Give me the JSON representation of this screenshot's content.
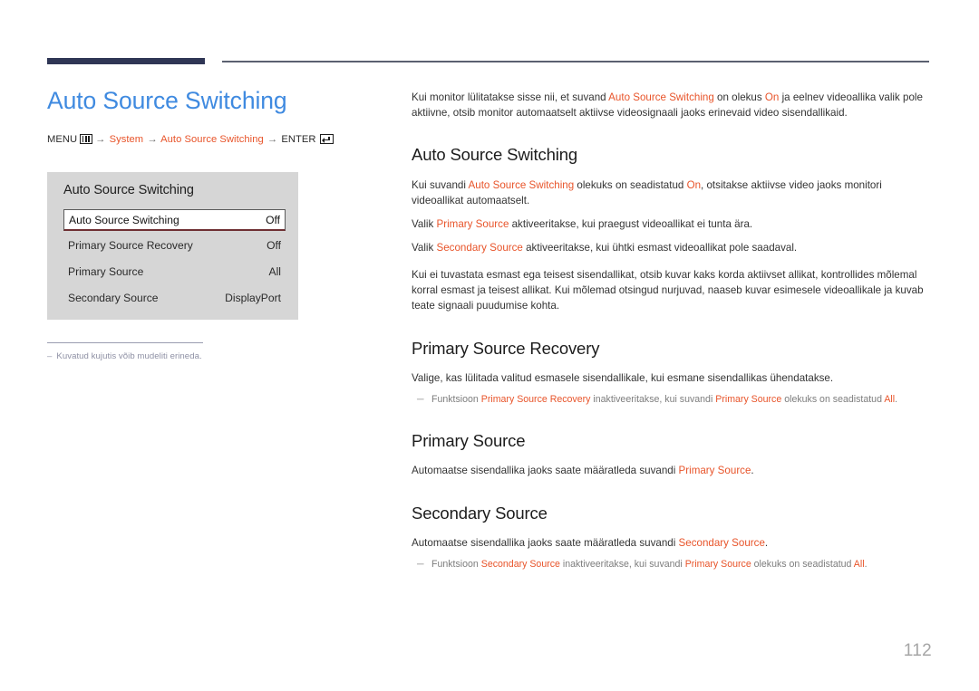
{
  "header": {
    "accent_bar_color": "#2f3655",
    "rule_color": "#5b6070"
  },
  "left": {
    "page_title": "Auto Source Switching",
    "menu_path": {
      "menu_label": "MENU",
      "menu_icon": "menu-icon",
      "arrow": "→",
      "step1": "System",
      "step2": "Auto Source Switching",
      "enter_label": "ENTER",
      "enter_icon": "enter-icon"
    },
    "osd": {
      "title": "Auto Source Switching",
      "rows": [
        {
          "label": "Auto Source Switching",
          "value": "Off",
          "selected": true
        },
        {
          "label": "Primary Source Recovery",
          "value": "Off",
          "selected": false
        },
        {
          "label": "Primary Source",
          "value": "All",
          "selected": false
        },
        {
          "label": "Secondary Source",
          "value": "DisplayPort",
          "selected": false
        }
      ]
    },
    "footnote": {
      "dash": "–",
      "text": "Kuvatud kujutis võib mudeliti erineda."
    }
  },
  "right": {
    "intro": {
      "part1": "Kui monitor lülitatakse sisse nii, et suvand ",
      "accent1": "Auto Source Switching",
      "part2": " on olekus ",
      "accent2": "On",
      "part3": " ja eelnev videoallika valik pole aktiivne, otsib monitor automaatselt aktiivse videosignaali jaoks erinevaid video sisendallikaid."
    },
    "sections": [
      {
        "heading": "Auto Source Switching",
        "paragraphs": [
          {
            "part1": "Kui suvandi ",
            "accent1": "Auto Source Switching",
            "part2": " olekuks on seadistatud ",
            "accent2": "On",
            "part3": ", otsitakse aktiivse video jaoks monitori videoallikat automaatselt."
          },
          {
            "part1": "Valik ",
            "accent1": "Primary Source",
            "part2": " aktiveeritakse, kui praegust videoallikat ei tunta ära.",
            "accent2": "",
            "part3": ""
          },
          {
            "part1": "Valik ",
            "accent1": "Secondary Source",
            "part2": " aktiveeritakse, kui ühtki esmast videoallikat pole saadaval.",
            "accent2": "",
            "part3": ""
          },
          {
            "part1": "Kui ei tuvastata esmast ega teisest sisendallikat, otsib kuvar kaks korda aktiivset allikat, kontrollides mõlemal korral esmast ja teisest allikat. Kui mõlemad otsingud nurjuvad, naaseb kuvar esimesele videoallikale ja kuvab teate signaali puudumise kohta.",
            "accent1": "",
            "part2": "",
            "accent2": "",
            "part3": ""
          }
        ],
        "note": null
      },
      {
        "heading": "Primary Source Recovery",
        "paragraphs": [
          {
            "part1": "Valige, kas lülitada valitud esmasele sisendallikale, kui esmane sisendallikas ühendatakse.",
            "accent1": "",
            "part2": "",
            "accent2": "",
            "part3": ""
          }
        ],
        "note": {
          "dash": "─",
          "part1": "Funktsioon ",
          "accent1": "Primary Source Recovery",
          "part2": " inaktiveeritakse, kui suvandi ",
          "accent2": "Primary Source",
          "part3": " olekuks on seadistatud ",
          "accent3": "All",
          "part4": "."
        }
      },
      {
        "heading": "Primary Source",
        "paragraphs": [
          {
            "part1": "Automaatse sisendallika jaoks saate määratleda suvandi ",
            "accent1": "Primary Source",
            "part2": ".",
            "accent2": "",
            "part3": ""
          }
        ],
        "note": null
      },
      {
        "heading": "Secondary Source",
        "paragraphs": [
          {
            "part1": "Automaatse sisendallika jaoks saate määratleda suvandi ",
            "accent1": "Secondary Source",
            "part2": ".",
            "accent2": "",
            "part3": ""
          }
        ],
        "note": {
          "dash": "─",
          "part1": "Funktsioon ",
          "accent1": "Secondary Source",
          "part2": " inaktiveeritakse, kui suvandi ",
          "accent2": "Primary Source",
          "part3": " olekuks on seadistatud ",
          "accent3": "All",
          "part4": "."
        }
      }
    ]
  },
  "footer": {
    "page_number": "112"
  }
}
